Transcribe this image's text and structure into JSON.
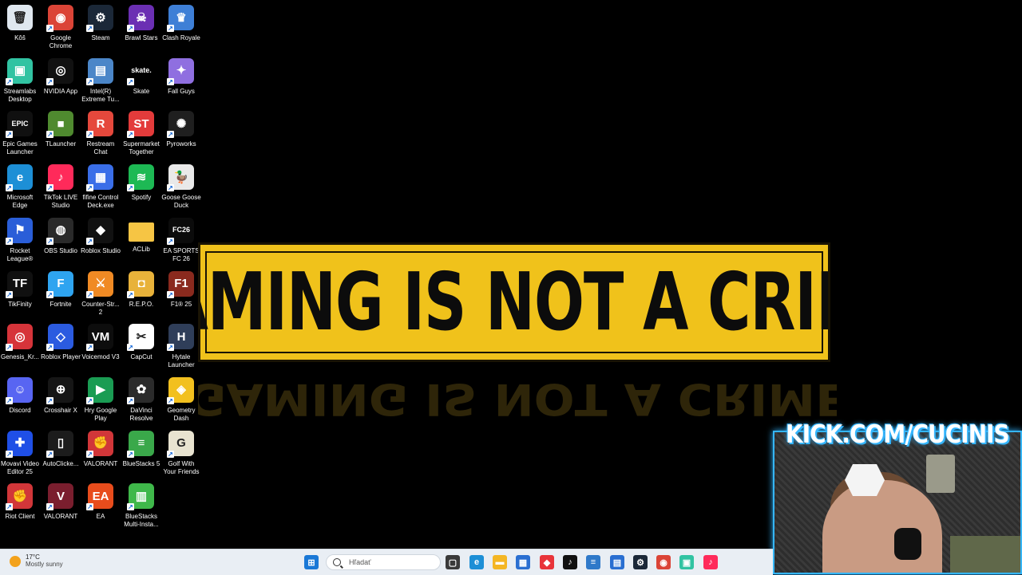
{
  "desktop_icons": [
    {
      "label": "Kôš",
      "icon": "recycle-bin-icon",
      "color": "#dfe7ef",
      "glyph": "🗑",
      "shortcut": false
    },
    {
      "label": "Google Chrome",
      "icon": "chrome-icon",
      "color": "#db4437",
      "glyph": "◉",
      "shortcut": true
    },
    {
      "label": "Steam",
      "icon": "steam-icon",
      "color": "#1b2838",
      "glyph": "⚙",
      "shortcut": true
    },
    {
      "label": "Brawl Stars",
      "icon": "brawl-stars-icon",
      "color": "#6b2fb3",
      "glyph": "☠",
      "shortcut": true
    },
    {
      "label": "Clash Royale",
      "icon": "clash-royale-icon",
      "color": "#3e7fd6",
      "glyph": "♛",
      "shortcut": true
    },
    {
      "label": "Streamlabs Desktop",
      "icon": "streamlabs-icon",
      "color": "#31c3a2",
      "glyph": "▣",
      "shortcut": true
    },
    {
      "label": "NVIDIA App",
      "icon": "nvidia-icon",
      "color": "#111111",
      "glyph": "◎",
      "shortcut": true
    },
    {
      "label": "Intel(R) Extreme Tu...",
      "icon": "intel-icon",
      "color": "#4b86c8",
      "glyph": "▤",
      "shortcut": true
    },
    {
      "label": "Skate",
      "icon": "skate-icon",
      "color": "#000000",
      "glyph": "skate.",
      "shortcut": true
    },
    {
      "label": "Fall Guys",
      "icon": "fall-guys-icon",
      "color": "#8f6fe0",
      "glyph": "✦",
      "shortcut": true
    },
    {
      "label": "Epic Games Launcher",
      "icon": "epic-games-icon",
      "color": "#101010",
      "glyph": "EPIC",
      "shortcut": true
    },
    {
      "label": "TLauncher",
      "icon": "tlauncher-icon",
      "color": "#4f8a2f",
      "glyph": "■",
      "shortcut": true
    },
    {
      "label": "Restream Chat",
      "icon": "restream-icon",
      "color": "#e5483c",
      "glyph": "R",
      "shortcut": true
    },
    {
      "label": "Supermarket Together",
      "icon": "supermarket-icon",
      "color": "#e33b3b",
      "glyph": "ST",
      "shortcut": true
    },
    {
      "label": "Pyroworks",
      "icon": "pyroworks-icon",
      "color": "#1f1f1f",
      "glyph": "✺",
      "shortcut": true
    },
    {
      "label": "Microsoft Edge",
      "icon": "edge-icon",
      "color": "#1d8fd6",
      "glyph": "e",
      "shortcut": true
    },
    {
      "label": "TikTok LIVE Studio",
      "icon": "tiktok-live-icon",
      "color": "#ff2a5a",
      "glyph": "♪",
      "shortcut": true
    },
    {
      "label": "fifine Control Deck.exe",
      "icon": "fifine-icon",
      "color": "#3a6ee8",
      "glyph": "▦",
      "shortcut": true
    },
    {
      "label": "Spotify",
      "icon": "spotify-icon",
      "color": "#1db954",
      "glyph": "≋",
      "shortcut": true
    },
    {
      "label": "Goose Goose Duck",
      "icon": "goose-icon",
      "color": "#e9e9e9",
      "glyph": "🦆",
      "shortcut": true
    },
    {
      "label": "Rocket League®",
      "icon": "rocket-league-icon",
      "color": "#2a5ed8",
      "glyph": "⚑",
      "shortcut": true
    },
    {
      "label": "OBS Studio",
      "icon": "obs-icon",
      "color": "#2a2a2a",
      "glyph": "◍",
      "shortcut": true
    },
    {
      "label": "Roblox Studio",
      "icon": "roblox-studio-icon",
      "color": "#111111",
      "glyph": "◆",
      "shortcut": true
    },
    {
      "label": "ACLib",
      "icon": "folder-icon",
      "color": "#f6c544",
      "glyph": "",
      "shortcut": false
    },
    {
      "label": "EA SPORTS FC 26",
      "icon": "ea-fc-icon",
      "color": "#0b0b0b",
      "glyph": "FC26",
      "shortcut": true
    },
    {
      "label": "TikFinity",
      "icon": "tikfinity-icon",
      "color": "#101010",
      "glyph": "TF",
      "shortcut": true
    },
    {
      "label": "Fortnite",
      "icon": "fortnite-icon",
      "color": "#2ea4f0",
      "glyph": "F",
      "shortcut": true
    },
    {
      "label": "Counter-Str... 2",
      "icon": "counter-strike-icon",
      "color": "#f08a24",
      "glyph": "⚔",
      "shortcut": true
    },
    {
      "label": "R.E.P.O.",
      "icon": "repo-icon",
      "color": "#e8b23a",
      "glyph": "◘",
      "shortcut": true
    },
    {
      "label": "F1® 25",
      "icon": "f1-icon",
      "color": "#8a2a1e",
      "glyph": "F1",
      "shortcut": true
    },
    {
      "label": "Genesis_Kr...",
      "icon": "genesis-icon",
      "color": "#d6343a",
      "glyph": "◎",
      "shortcut": true
    },
    {
      "label": "Roblox Player",
      "icon": "roblox-icon",
      "color": "#2b5be0",
      "glyph": "◇",
      "shortcut": true
    },
    {
      "label": "Voicemod V3",
      "icon": "voicemod-icon",
      "color": "#0d0d0d",
      "glyph": "VM",
      "shortcut": true
    },
    {
      "label": "CapCut",
      "icon": "capcut-icon",
      "color": "#ffffff",
      "glyph": "✂",
      "shortcut": true
    },
    {
      "label": "Hytale Launcher",
      "icon": "hytale-icon",
      "color": "#2f3e59",
      "glyph": "H",
      "shortcut": true
    },
    {
      "label": "Discord",
      "icon": "discord-icon",
      "color": "#5865f2",
      "glyph": "☺",
      "shortcut": true
    },
    {
      "label": "Crosshair X",
      "icon": "crosshair-icon",
      "color": "#161616",
      "glyph": "⊕",
      "shortcut": true
    },
    {
      "label": "Hry Google Play",
      "icon": "google-play-icon",
      "color": "#1a9c53",
      "glyph": "▶",
      "shortcut": true
    },
    {
      "label": "DaVinci Resolve",
      "icon": "davinci-icon",
      "color": "#2b2b2b",
      "glyph": "✿",
      "shortcut": true
    },
    {
      "label": "Geometry Dash",
      "icon": "geometry-dash-icon",
      "color": "#f2c01e",
      "glyph": "◈",
      "shortcut": true
    },
    {
      "label": "Movavi Video Editor 25",
      "icon": "movavi-icon",
      "color": "#1f4fe6",
      "glyph": "✚",
      "shortcut": true
    },
    {
      "label": "AutoClicke...",
      "icon": "mouse-icon",
      "color": "#1c1c1c",
      "glyph": "▯",
      "shortcut": true
    },
    {
      "label": "VALORANT",
      "icon": "riot-icon",
      "color": "#d13639",
      "glyph": "✊",
      "shortcut": true
    },
    {
      "label": "BlueStacks 5",
      "icon": "bluestacks-icon",
      "color": "#3aa84a",
      "glyph": "≡",
      "shortcut": true
    },
    {
      "label": "Golf With Your Friends",
      "icon": "golf-icon",
      "color": "#e8e3d0",
      "glyph": "G",
      "shortcut": true
    },
    {
      "label": "Riot Client",
      "icon": "riot-client-icon",
      "color": "#d13639",
      "glyph": "✊",
      "shortcut": true
    },
    {
      "label": "VALORANT",
      "icon": "valorant-icon",
      "color": "#7a1e2e",
      "glyph": "V",
      "shortcut": true
    },
    {
      "label": "EA",
      "icon": "ea-icon",
      "color": "#e84c1c",
      "glyph": "EA",
      "shortcut": true
    },
    {
      "label": "BlueStacks Multi-Insta...",
      "icon": "bluestacks-multi-icon",
      "color": "#3fb84a",
      "glyph": "▥",
      "shortcut": true
    }
  ],
  "wallpaper": {
    "text": "GAMING IS NOT A CRIME",
    "background": "#000000",
    "tape_color": "#f0c21b"
  },
  "webcam": {
    "overlay_text": "KICK.COM/CUCINIS",
    "border_color": "#35b6ff"
  },
  "taskbar": {
    "weather_temp": "17°C",
    "weather_desc": "Mostly sunny",
    "search_placeholder": "Hľadať",
    "pinned": [
      {
        "icon": "windows-start-icon",
        "color": "#1a78d6",
        "glyph": "⊞"
      },
      {
        "icon": "task-view-icon",
        "color": "#3a3a3a",
        "glyph": "▢"
      },
      {
        "icon": "edge-taskbar-icon",
        "color": "#1d8fd6",
        "glyph": "e"
      },
      {
        "icon": "file-explorer-icon",
        "color": "#f4b624",
        "glyph": "▬"
      },
      {
        "icon": "store-icon",
        "color": "#2a6fd1",
        "glyph": "▦"
      },
      {
        "icon": "app-red-icon",
        "color": "#e8343a",
        "glyph": "◆"
      },
      {
        "icon": "tiktok-icon",
        "color": "#111111",
        "glyph": "♪"
      },
      {
        "icon": "notes-icon",
        "color": "#2f79c9",
        "glyph": "≡"
      },
      {
        "icon": "photos-icon",
        "color": "#2a6fd1",
        "glyph": "▤"
      },
      {
        "icon": "steam-taskbar-icon",
        "color": "#1b2838",
        "glyph": "⚙"
      },
      {
        "icon": "chrome-taskbar-icon",
        "color": "#db4437",
        "glyph": "◉"
      },
      {
        "icon": "streamlabs-taskbar-icon",
        "color": "#31c3a2",
        "glyph": "▣"
      },
      {
        "icon": "tiktok-live-taskbar-icon",
        "color": "#ff2a5a",
        "glyph": "♪"
      }
    ]
  }
}
